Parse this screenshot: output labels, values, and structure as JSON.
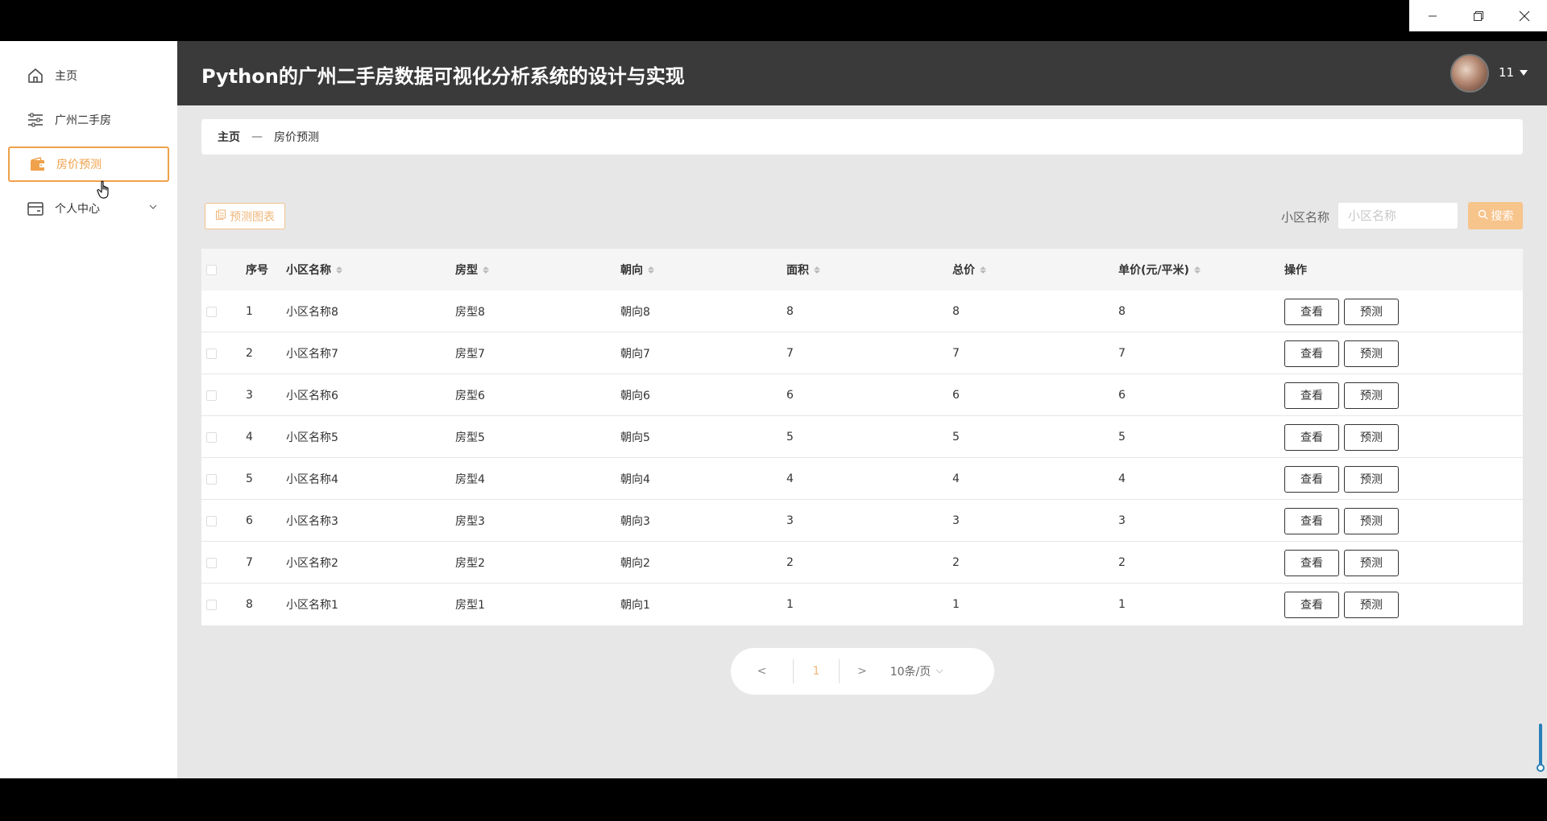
{
  "window": {
    "minimize": "minimize",
    "restore": "restore",
    "close": "close"
  },
  "sidebar": {
    "items": [
      {
        "label": "主页",
        "icon": "home-icon"
      },
      {
        "label": "广州二手房",
        "icon": "sliders-icon"
      },
      {
        "label": "房价预测",
        "icon": "wallet-icon",
        "active": true
      },
      {
        "label": "个人中心",
        "icon": "card-icon"
      }
    ]
  },
  "header": {
    "title": "Python的广州二手房数据可视化分析系统的设计与实现",
    "username": "11"
  },
  "breadcrumb": {
    "home": "主页",
    "separator": "—",
    "current": "房价预测"
  },
  "toolbar": {
    "chart_button": "预测图表",
    "search_label": "小区名称",
    "search_placeholder": "小区名称",
    "search_button": "搜索"
  },
  "table": {
    "columns": [
      "序号",
      "小区名称",
      "房型",
      "朝向",
      "面积",
      "总价",
      "单价(元/平米)",
      "操作"
    ],
    "rows": [
      {
        "no": "1",
        "name": "小区名称8",
        "type": "房型8",
        "dir": "朝向8",
        "area": "8",
        "total": "8",
        "unit": "8"
      },
      {
        "no": "2",
        "name": "小区名称7",
        "type": "房型7",
        "dir": "朝向7",
        "area": "7",
        "total": "7",
        "unit": "7"
      },
      {
        "no": "3",
        "name": "小区名称6",
        "type": "房型6",
        "dir": "朝向6",
        "area": "6",
        "total": "6",
        "unit": "6"
      },
      {
        "no": "4",
        "name": "小区名称5",
        "type": "房型5",
        "dir": "朝向5",
        "area": "5",
        "total": "5",
        "unit": "5"
      },
      {
        "no": "5",
        "name": "小区名称4",
        "type": "房型4",
        "dir": "朝向4",
        "area": "4",
        "total": "4",
        "unit": "4"
      },
      {
        "no": "6",
        "name": "小区名称3",
        "type": "房型3",
        "dir": "朝向3",
        "area": "3",
        "total": "3",
        "unit": "3"
      },
      {
        "no": "7",
        "name": "小区名称2",
        "type": "房型2",
        "dir": "朝向2",
        "area": "2",
        "total": "2",
        "unit": "2"
      },
      {
        "no": "8",
        "name": "小区名称1",
        "type": "房型1",
        "dir": "朝向1",
        "area": "1",
        "total": "1",
        "unit": "1"
      }
    ],
    "view_label": "查看",
    "predict_label": "预测"
  },
  "pagination": {
    "prev": "<",
    "page": "1",
    "next": ">",
    "page_size": "10条/页"
  },
  "colors": {
    "accent": "#f0a14a",
    "header_bg": "#3a3a3a",
    "search_btn": "#f7c48c"
  }
}
